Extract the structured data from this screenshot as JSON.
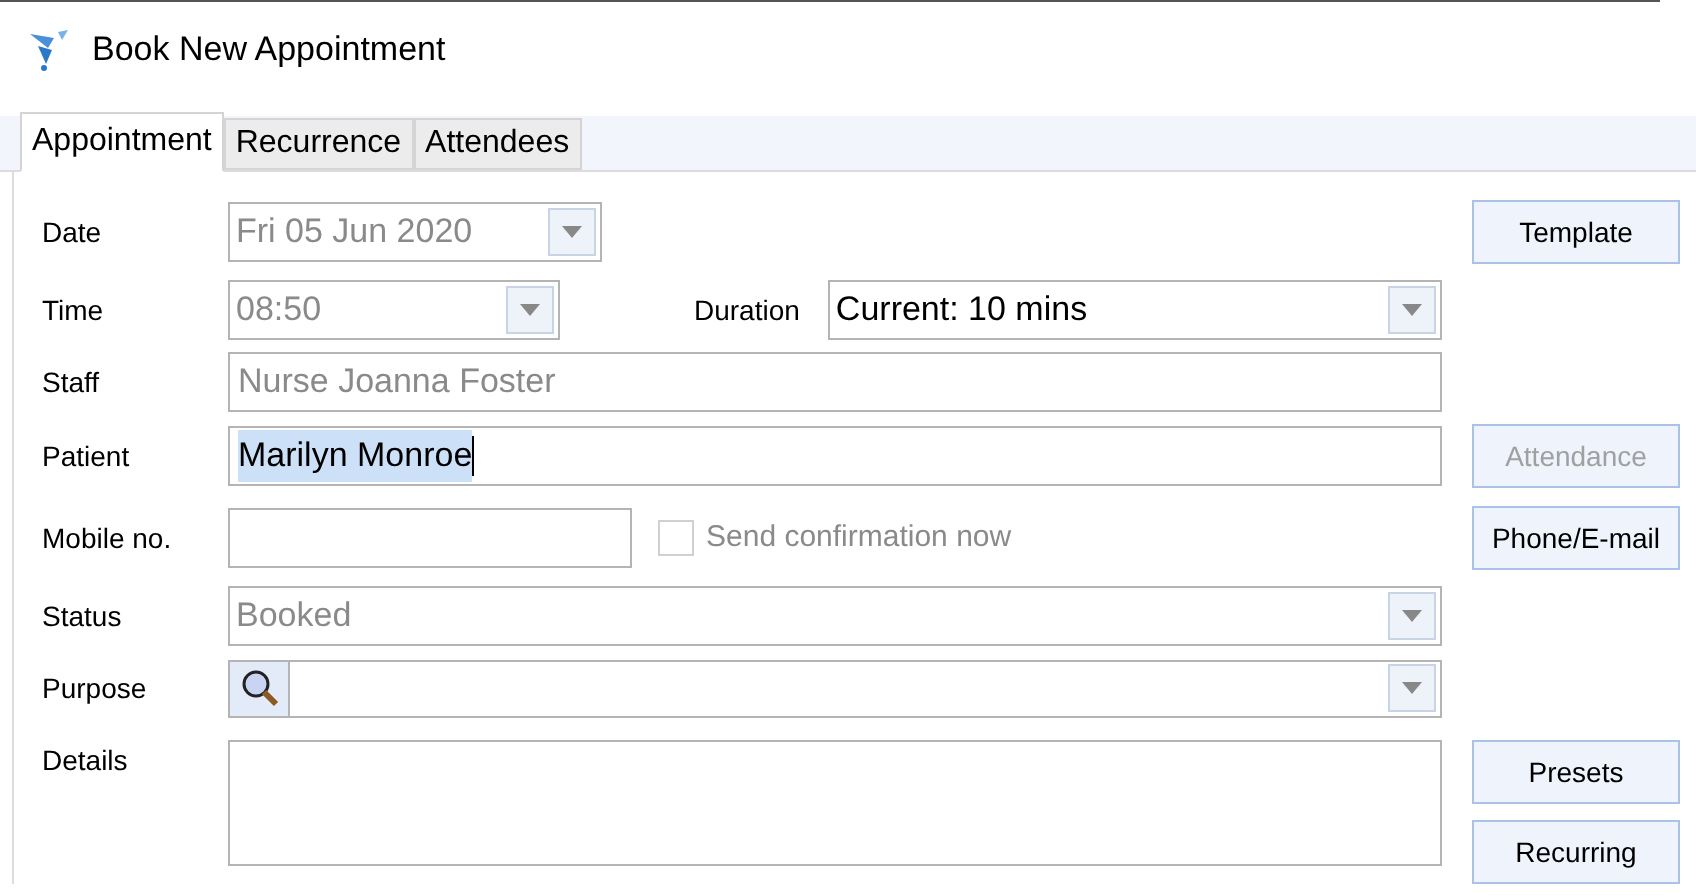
{
  "window": {
    "title": "Book New Appointment"
  },
  "tabs": [
    {
      "label": "Appointment",
      "selected": true
    },
    {
      "label": "Recurrence",
      "selected": false
    },
    {
      "label": "Attendees",
      "selected": false
    }
  ],
  "rows": [
    {
      "kind": "combo-short",
      "label": "Date",
      "value": "Fri 05 Jun 2020",
      "disabled": true,
      "button": {
        "label": "Template",
        "disabled": false
      }
    },
    {
      "kind": "combo-duration",
      "label": "Time",
      "value": "08:50",
      "disabled": true,
      "duration": {
        "label": "Duration",
        "value": "Current: 10 mins",
        "disabled": false
      }
    },
    {
      "kind": "text",
      "label": "Staff",
      "value": "Nurse Joanna Foster",
      "disabled": true
    },
    {
      "kind": "text",
      "label": "Patient",
      "value": "Marilyn Monroe",
      "disabled": false,
      "selected": true,
      "button": {
        "label": "Attendance",
        "disabled": true
      }
    },
    {
      "kind": "mobile",
      "label": "Mobile no.",
      "checkbox": {
        "label": "Send confirmation now",
        "checked": false,
        "disabled": true
      },
      "button": {
        "label": "Phone/E-mail",
        "disabled": false
      }
    },
    {
      "kind": "combo",
      "label": "Status",
      "value": "Booked",
      "disabled": true
    },
    {
      "kind": "lookup",
      "label": "Purpose"
    },
    {
      "kind": "memo",
      "label": "Details",
      "buttons": [
        {
          "label": "Presets",
          "disabled": false
        },
        {
          "label": "Recurring",
          "disabled": false
        }
      ]
    }
  ]
}
